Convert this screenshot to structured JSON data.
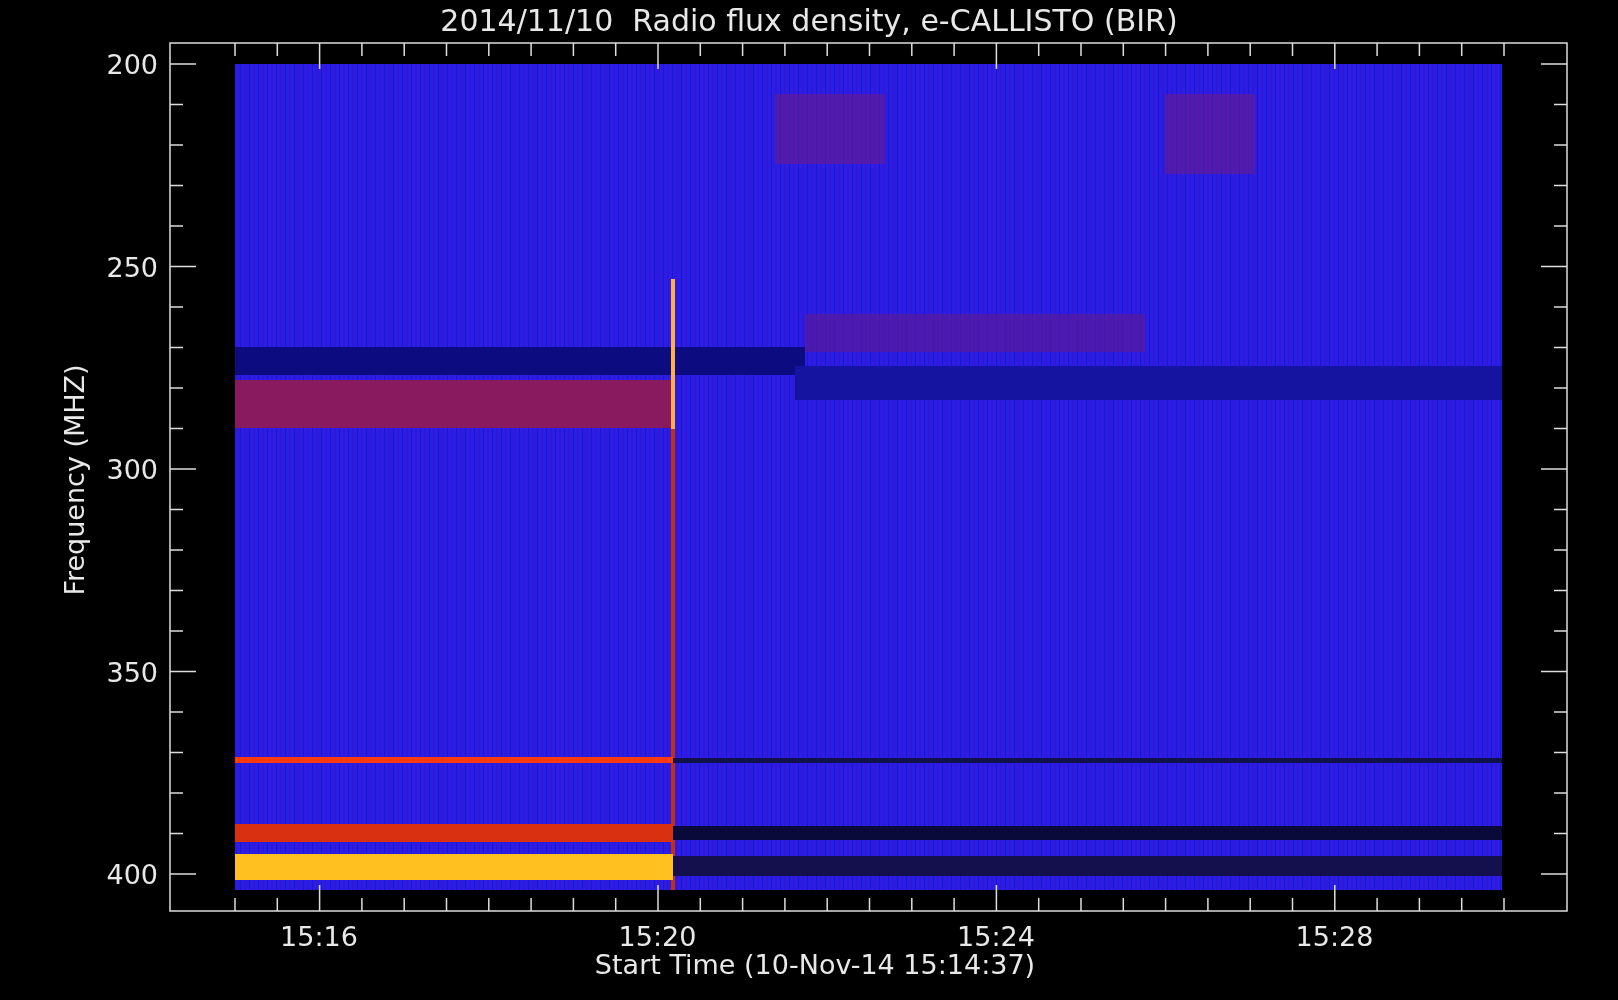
{
  "title": "2014/11/10  Radio flux density, e-CALLISTO (BIR)",
  "y_axis": {
    "label": "Frequency (MHZ)",
    "tick_labels": [
      "200",
      "250",
      "300",
      "350",
      "400"
    ]
  },
  "x_axis": {
    "label": "Start Time (10-Nov-14 15:14:37)",
    "tick_labels": [
      "15:16",
      "15:20",
      "15:24",
      "15:28"
    ]
  }
}
